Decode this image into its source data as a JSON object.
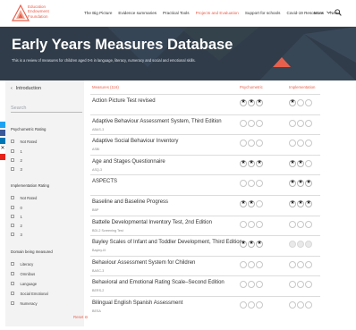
{
  "colors": {
    "accent": "#e8604c",
    "hero": "#303c49",
    "sidebar": "#f3f3f4"
  },
  "header": {
    "logo_lines": [
      "Education",
      "Endowment",
      "Foundation"
    ],
    "nav": [
      "The Big Picture",
      "Evidence summaries",
      "Practical Tools",
      "Projects and Evaluation",
      "Support for schools",
      "Covid-19 Resources",
      "News"
    ],
    "active_nav": "Projects and Evaluation",
    "more": "More",
    "icons": {
      "chevron": "chevron-down-icon",
      "search": "search-icon"
    }
  },
  "hero": {
    "title": "Early Years Measures Database",
    "subtitle": "This is a review of measures for children aged 0-6 in language, literacy, numeracy and social and emotional skills."
  },
  "sidebar": {
    "back": "Introduction",
    "search_placeholder": "Search",
    "psychometric_heading": "Psychometric Rating",
    "psychometric_options": [
      "Not Rated",
      "1",
      "2",
      "3"
    ],
    "implementation_heading": "Implementation Rating",
    "implementation_options": [
      "Not Rated",
      "0",
      "1",
      "2",
      "3"
    ],
    "domain_heading": "Domain being measured",
    "domain_options": [
      "Literacy",
      "Omnibus",
      "Language",
      "Social Emotional",
      "Numeracy"
    ],
    "reset": "Reset",
    "social_icons": [
      "twitter-icon",
      "facebook-icon",
      "linkedin-icon",
      "email-icon",
      "youtube-icon"
    ]
  },
  "table": {
    "columns": {
      "measures": "Measures (116)",
      "psychometric": "Psychometric",
      "implementation": "Implementation"
    },
    "star_glyph": "★",
    "rows": [
      {
        "name": "Action Picture Test revised",
        "abbr": "",
        "psychometric": 3,
        "implementation": 1
      },
      {
        "name": "Adaptive Behaviour Assessment System, Third Edition",
        "abbr": "ABAS-3",
        "psychometric": 0,
        "implementation": 0
      },
      {
        "name": "Adaptive Social Behaviour Inventory",
        "abbr": "ASBI",
        "psychometric": 0,
        "implementation": 0
      },
      {
        "name": "Age and Stages Questionnaire",
        "abbr": "ASQ-3",
        "psychometric": 3,
        "implementation": 2
      },
      {
        "name": "ASPECTS",
        "abbr": "",
        "psychometric": 0,
        "implementation": 3
      },
      {
        "name": "Baseline and Baseline Progress",
        "abbr": "BBP",
        "psychometric": 2,
        "implementation": 3
      },
      {
        "name": "Battelle Developmental Inventory Test, 2nd Edition",
        "abbr": "BDI-2 Screening Test",
        "psychometric": 0,
        "implementation": 0
      },
      {
        "name": "Bayley Scales of Infant and Toddler Development, Third Edition",
        "abbr": "Bayley-III",
        "psychometric": 3,
        "implementation": 0,
        "implementation_muted": true
      },
      {
        "name": "Behaviour Assessment System for Children",
        "abbr": "BASC-3",
        "psychometric": 0,
        "implementation": 0
      },
      {
        "name": "Behavioral and Emotional Rating Scale–Second Edition",
        "abbr": "BERS-2",
        "psychometric": 0,
        "implementation": 0
      },
      {
        "name": "Bilingual English Spanish Assessment",
        "abbr": "BESA",
        "psychometric": 0,
        "implementation": 0
      }
    ]
  }
}
